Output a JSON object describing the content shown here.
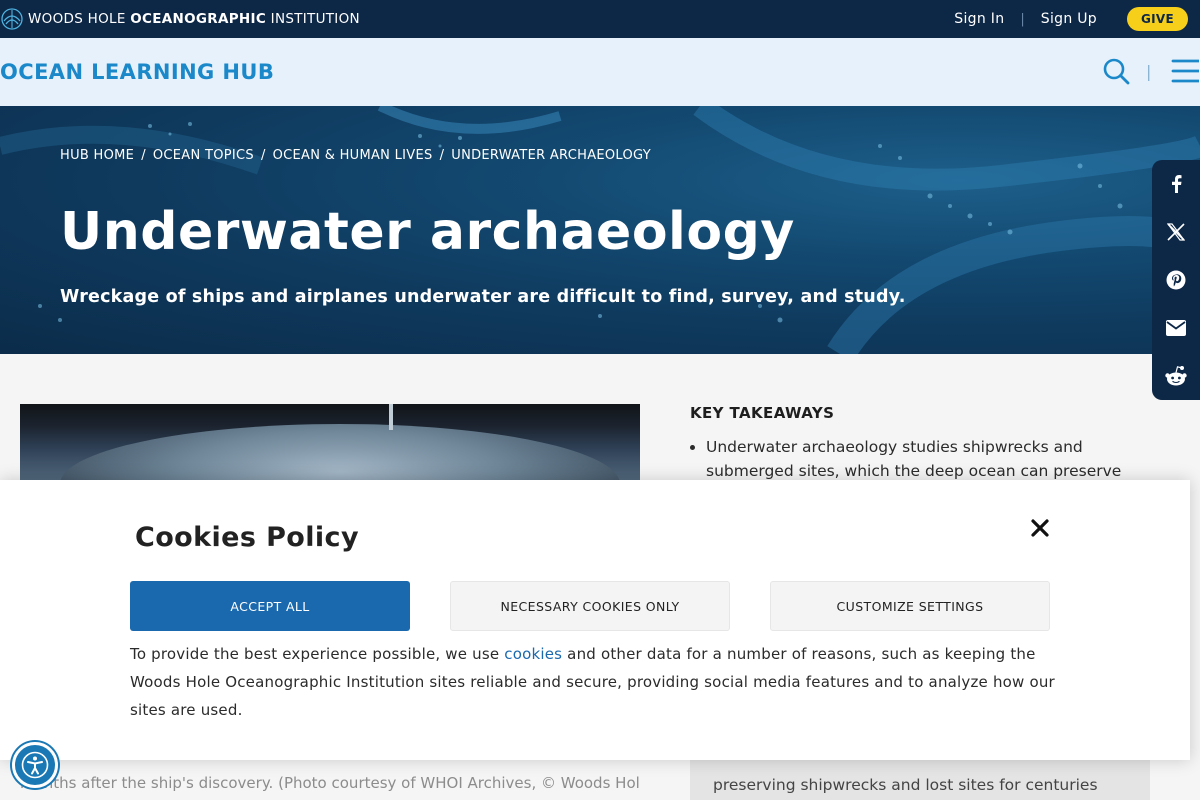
{
  "topbar": {
    "org_name_prefix": "WOODS HOLE",
    "org_name_bold": "OCEANOGRAPHIC",
    "org_name_suffix": "INSTITUTION",
    "sign_in": "Sign In",
    "separator": "|",
    "sign_up": "Sign Up",
    "give": "GIVE"
  },
  "hub": {
    "title": "OCEAN LEARNING HUB",
    "divider": "|"
  },
  "hero": {
    "breadcrumbs": [
      "HUB HOME",
      "OCEAN TOPICS",
      "OCEAN & HUMAN LIVES",
      "UNDERWATER ARCHAEOLOGY"
    ],
    "breadcrumb_separator": "/",
    "title": "Underwater archaeology",
    "subtitle": "Wreckage of ships and airplanes underwater are difficult to find, survey, and study."
  },
  "share": [
    "facebook-icon",
    "x-icon",
    "pinterest-icon",
    "email-icon",
    "reddit-icon"
  ],
  "takeaways": {
    "heading": "KEY TAKEAWAYS",
    "items": [
      "Underwater archaeology studies shipwrecks and submerged sites, which the deep ocean can preserve"
    ]
  },
  "behind_modal": {
    "caption": "months after the ship's discovery. (Photo courtesy of WHOI Archives, © Woods Hole",
    "box_text": "preserving shipwrecks and lost sites for centuries"
  },
  "cookies": {
    "title": "Cookies Policy",
    "accept_all": "ACCEPT ALL",
    "necessary_only": "NECESSARY COOKIES ONLY",
    "customize": "CUSTOMIZE SETTINGS",
    "text_before_link": "To provide the best experience possible, we use ",
    "link_text": "cookies",
    "text_after_link": " and other data for a number of reasons, such as keeping the Woods Hole Oceanographic Institution sites reliable and secure, providing social media features and to analyze how our sites are used."
  },
  "colors": {
    "navy": "#0d2747",
    "hub_blue": "#1a88c9",
    "give_yellow": "#f6cf1b",
    "primary_button": "#1a69ae"
  }
}
